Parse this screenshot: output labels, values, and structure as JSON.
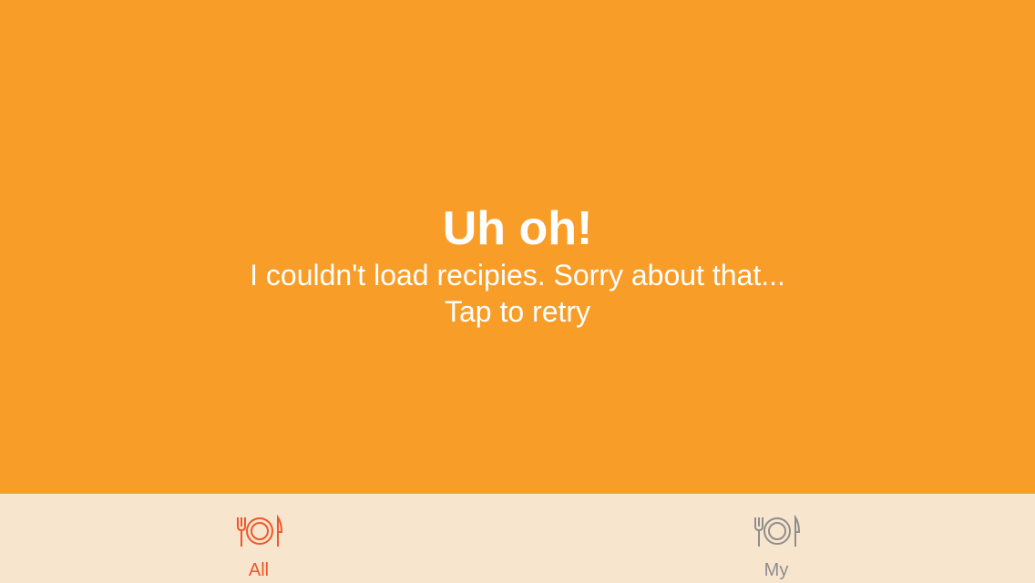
{
  "error": {
    "title": "Uh oh!",
    "message": "I couldn't load recipies. Sorry about that...",
    "retry_label": "Tap to retry"
  },
  "tabbar": {
    "tabs": [
      {
        "label": "All",
        "icon": "plate-fork-knife-icon",
        "selected": true,
        "color": "#F0562A"
      },
      {
        "label": "My",
        "icon": "plate-fork-knife-icon",
        "selected": false,
        "color": "#8E8E8E"
      }
    ]
  },
  "colors": {
    "background": "#F99D29",
    "tabbar_background": "#F8E5CD",
    "text": "#FFFFFF"
  }
}
